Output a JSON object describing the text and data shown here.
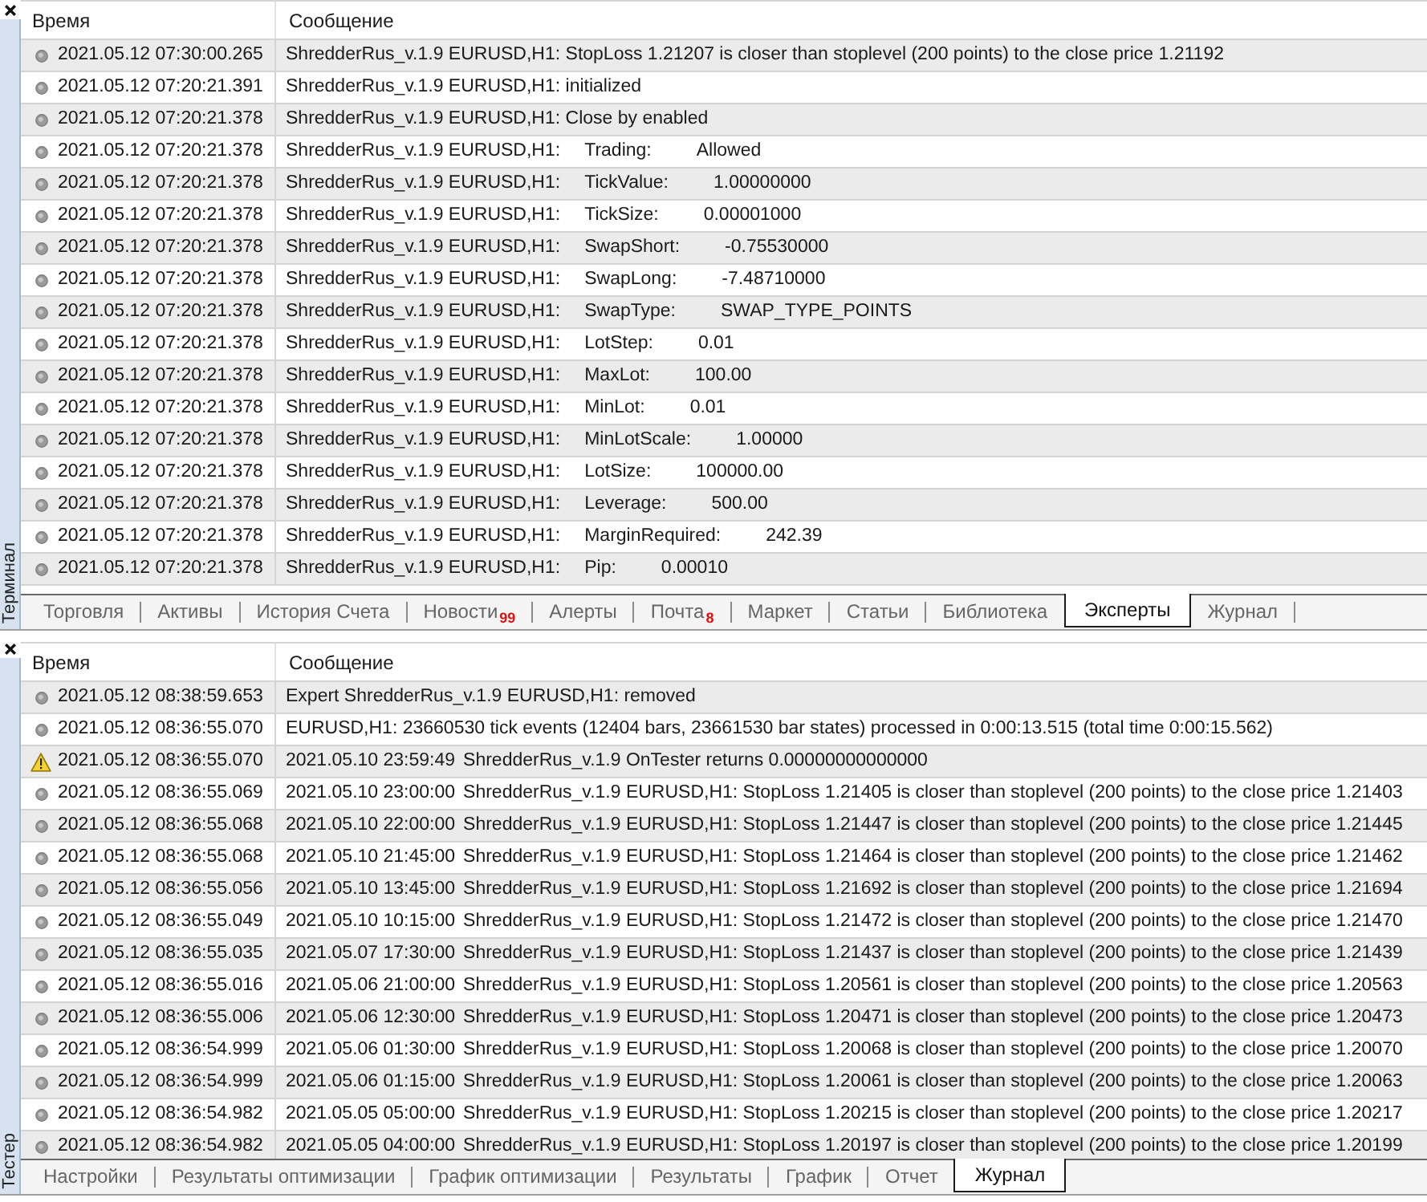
{
  "terminal": {
    "label": "Терминал",
    "columns": [
      "Время",
      "Сообщение"
    ],
    "rows": [
      {
        "kind": "info",
        "time": "2021.05.12 07:30:00.265",
        "message": "ShredderRus_v.1.9 EURUSD,H1: StopLoss 1.21207 is closer than stoplevel (200 points) to the close price 1.21192"
      },
      {
        "kind": "info",
        "time": "2021.05.12 07:20:21.391",
        "message": "ShredderRus_v.1.9 EURUSD,H1: initialized"
      },
      {
        "kind": "info",
        "time": "2021.05.12 07:20:21.378",
        "message": "ShredderRus_v.1.9 EURUSD,H1: Close by enabled"
      },
      {
        "kind": "info",
        "time": "2021.05.12 07:20:21.378",
        "message": "ShredderRus_v.1.9 EURUSD,H1:",
        "param": "Trading:",
        "value": "Allowed"
      },
      {
        "kind": "info",
        "time": "2021.05.12 07:20:21.378",
        "message": "ShredderRus_v.1.9 EURUSD,H1:",
        "param": "TickValue:",
        "value": "1.00000000"
      },
      {
        "kind": "info",
        "time": "2021.05.12 07:20:21.378",
        "message": "ShredderRus_v.1.9 EURUSD,H1:",
        "param": "TickSize:",
        "value": "0.00001000"
      },
      {
        "kind": "info",
        "time": "2021.05.12 07:20:21.378",
        "message": "ShredderRus_v.1.9 EURUSD,H1:",
        "param": "SwapShort:",
        "value": "-0.75530000"
      },
      {
        "kind": "info",
        "time": "2021.05.12 07:20:21.378",
        "message": "ShredderRus_v.1.9 EURUSD,H1:",
        "param": "SwapLong:",
        "value": "-7.48710000"
      },
      {
        "kind": "info",
        "time": "2021.05.12 07:20:21.378",
        "message": "ShredderRus_v.1.9 EURUSD,H1:",
        "param": "SwapType:",
        "value": "SWAP_TYPE_POINTS"
      },
      {
        "kind": "info",
        "time": "2021.05.12 07:20:21.378",
        "message": "ShredderRus_v.1.9 EURUSD,H1:",
        "param": "LotStep:",
        "value": "0.01"
      },
      {
        "kind": "info",
        "time": "2021.05.12 07:20:21.378",
        "message": "ShredderRus_v.1.9 EURUSD,H1:",
        "param": "MaxLot:",
        "value": "100.00"
      },
      {
        "kind": "info",
        "time": "2021.05.12 07:20:21.378",
        "message": "ShredderRus_v.1.9 EURUSD,H1:",
        "param": "MinLot:",
        "value": "0.01"
      },
      {
        "kind": "info",
        "time": "2021.05.12 07:20:21.378",
        "message": "ShredderRus_v.1.9 EURUSD,H1:",
        "param": "MinLotScale:",
        "value": "1.00000"
      },
      {
        "kind": "info",
        "time": "2021.05.12 07:20:21.378",
        "message": "ShredderRus_v.1.9 EURUSD,H1:",
        "param": "LotSize:",
        "value": "100000.00"
      },
      {
        "kind": "info",
        "time": "2021.05.12 07:20:21.378",
        "message": "ShredderRus_v.1.9 EURUSD,H1:",
        "param": "Leverage:",
        "value": "500.00"
      },
      {
        "kind": "info",
        "time": "2021.05.12 07:20:21.378",
        "message": "ShredderRus_v.1.9 EURUSD,H1:",
        "param": "MarginRequired:",
        "value": "242.39"
      },
      {
        "kind": "info",
        "time": "2021.05.12 07:20:21.378",
        "message": "ShredderRus_v.1.9 EURUSD,H1:",
        "param": "Pip:",
        "value": "0.00010"
      }
    ],
    "tabs": [
      {
        "label": "Торговля",
        "selected": false
      },
      {
        "label": "Активы",
        "selected": false
      },
      {
        "label": "История Счета",
        "selected": false
      },
      {
        "label": "Новости",
        "badge": "99",
        "selected": false
      },
      {
        "label": "Алерты",
        "selected": false
      },
      {
        "label": "Почта",
        "badge": "8",
        "selected": false
      },
      {
        "label": "Маркет",
        "selected": false
      },
      {
        "label": "Статьи",
        "selected": false
      },
      {
        "label": "Библиотека",
        "selected": false
      },
      {
        "label": "Эксперты",
        "selected": true
      },
      {
        "label": "Журнал",
        "selected": false
      }
    ]
  },
  "tester": {
    "label": "Тестер",
    "columns": [
      "Время",
      "Сообщение"
    ],
    "rows": [
      {
        "kind": "info",
        "time": "2021.05.12 08:38:59.653",
        "message": "Expert ShredderRus_v.1.9 EURUSD,H1: removed"
      },
      {
        "kind": "info",
        "time": "2021.05.12 08:36:55.070",
        "message": "EURUSD,H1: 23660530 tick events (12404 bars, 23661530 bar states) processed in 0:00:13.515 (total time 0:00:15.562)"
      },
      {
        "kind": "warning",
        "time": "2021.05.12 08:36:55.070",
        "sim_time": "2021.05.10 23:59:49",
        "message": "ShredderRus_v.1.9 OnTester returns 0.00000000000000"
      },
      {
        "kind": "info",
        "time": "2021.05.12 08:36:55.069",
        "sim_time": "2021.05.10 23:00:00",
        "message": "ShredderRus_v.1.9 EURUSD,H1: StopLoss 1.21405 is closer than stoplevel (200 points) to the close price 1.21403"
      },
      {
        "kind": "info",
        "time": "2021.05.12 08:36:55.068",
        "sim_time": "2021.05.10 22:00:00",
        "message": "ShredderRus_v.1.9 EURUSD,H1: StopLoss 1.21447 is closer than stoplevel (200 points) to the close price 1.21445"
      },
      {
        "kind": "info",
        "time": "2021.05.12 08:36:55.068",
        "sim_time": "2021.05.10 21:45:00",
        "message": "ShredderRus_v.1.9 EURUSD,H1: StopLoss 1.21464 is closer than stoplevel (200 points) to the close price 1.21462"
      },
      {
        "kind": "info",
        "time": "2021.05.12 08:36:55.056",
        "sim_time": "2021.05.10 13:45:00",
        "message": "ShredderRus_v.1.9 EURUSD,H1: StopLoss 1.21692 is closer than stoplevel (200 points) to the close price 1.21694"
      },
      {
        "kind": "info",
        "time": "2021.05.12 08:36:55.049",
        "sim_time": "2021.05.10 10:15:00",
        "message": "ShredderRus_v.1.9 EURUSD,H1: StopLoss 1.21472 is closer than stoplevel (200 points) to the close price 1.21470"
      },
      {
        "kind": "info",
        "time": "2021.05.12 08:36:55.035",
        "sim_time": "2021.05.07 17:30:00",
        "message": "ShredderRus_v.1.9 EURUSD,H1: StopLoss 1.21437 is closer than stoplevel (200 points) to the close price 1.21439"
      },
      {
        "kind": "info",
        "time": "2021.05.12 08:36:55.016",
        "sim_time": "2021.05.06 21:00:00",
        "message": "ShredderRus_v.1.9 EURUSD,H1: StopLoss 1.20561 is closer than stoplevel (200 points) to the close price 1.20563"
      },
      {
        "kind": "info",
        "time": "2021.05.12 08:36:55.006",
        "sim_time": "2021.05.06 12:30:00",
        "message": "ShredderRus_v.1.9 EURUSD,H1: StopLoss 1.20471 is closer than stoplevel (200 points) to the close price 1.20473"
      },
      {
        "kind": "info",
        "time": "2021.05.12 08:36:54.999",
        "sim_time": "2021.05.06 01:30:00",
        "message": "ShredderRus_v.1.9 EURUSD,H1: StopLoss 1.20068 is closer than stoplevel (200 points) to the close price 1.20070"
      },
      {
        "kind": "info",
        "time": "2021.05.12 08:36:54.999",
        "sim_time": "2021.05.06 01:15:00",
        "message": "ShredderRus_v.1.9 EURUSD,H1: StopLoss 1.20061 is closer than stoplevel (200 points) to the close price 1.20063"
      },
      {
        "kind": "info",
        "time": "2021.05.12 08:36:54.982",
        "sim_time": "2021.05.05 05:00:00",
        "message": "ShredderRus_v.1.9 EURUSD,H1: StopLoss 1.20215 is closer than stoplevel (200 points) to the close price 1.20217"
      },
      {
        "kind": "info",
        "time": "2021.05.12 08:36:54.982",
        "sim_time": "2021.05.05 04:00:00",
        "message": "ShredderRus_v.1.9 EURUSD,H1: StopLoss 1.20197 is closer than stoplevel (200 points) to the close price 1.20199"
      }
    ],
    "tabs": [
      {
        "label": "Настройки",
        "selected": false
      },
      {
        "label": "Результаты оптимизации",
        "selected": false
      },
      {
        "label": "График оптимизации",
        "selected": false
      },
      {
        "label": "Результаты",
        "selected": false
      },
      {
        "label": "График",
        "selected": false
      },
      {
        "label": "Отчет",
        "selected": false
      },
      {
        "label": "Журнал",
        "selected": true
      }
    ]
  }
}
